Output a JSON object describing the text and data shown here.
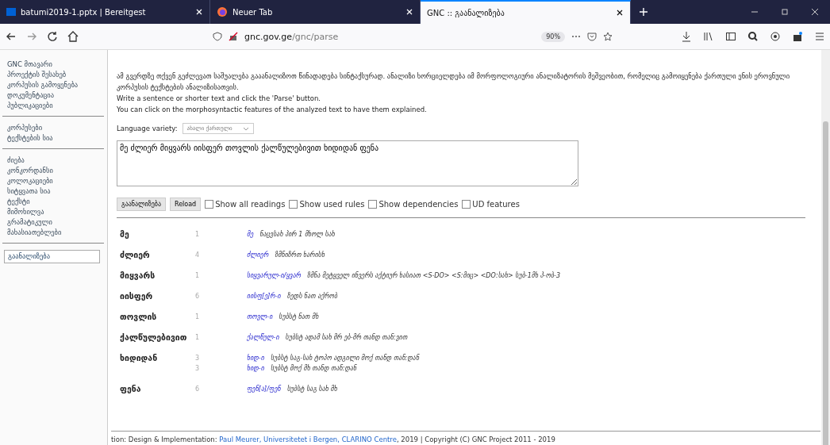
{
  "browser": {
    "tabs": [
      {
        "title": "batumi2019-1.pptx | Bereitgest",
        "selected": false,
        "kind": "box"
      },
      {
        "title": "Neuer Tab",
        "selected": false,
        "kind": "firefox"
      },
      {
        "title": "GNC :: გაანალიზება",
        "selected": true,
        "kind": "gnc"
      }
    ],
    "url_host": "gnc.gov.ge",
    "url_path": "/gnc/parse",
    "zoom": "90%"
  },
  "sidebar": {
    "groups": [
      [
        {
          "label": "GNC მთავარი",
          "selected": false
        },
        {
          "label": "პროექტის შესახებ",
          "selected": false
        },
        {
          "label": "კორპუსის გამოყენება",
          "selected": false
        },
        {
          "label": "დოკუმენტაცია",
          "selected": false
        },
        {
          "label": "პუბლიკაციები",
          "selected": false
        }
      ],
      [
        {
          "label": "კორპუსები",
          "selected": false
        },
        {
          "label": "ტექსტების სია",
          "selected": false
        }
      ],
      [
        {
          "label": "ძიება",
          "selected": false
        },
        {
          "label": "კონკორდანსი",
          "selected": false
        },
        {
          "label": "კოლოკაციები",
          "selected": false
        },
        {
          "label": "სიტყვათა სია",
          "selected": false
        },
        {
          "label": "ტექსტი",
          "selected": false
        },
        {
          "label": "მიმოხილვა",
          "selected": false
        },
        {
          "label": "გრამატიკული მახასიათებლები",
          "selected": false
        }
      ],
      [
        {
          "label": "გაანალიზება",
          "selected": true
        }
      ]
    ]
  },
  "intro": [
    "ამ გვერდზე თქვენ გეძლევათ საშუალება გააანალიზოთ წინადადება სინტაქსურად. ანალიზი ხორციელდება იმ მორფოლოგიური ანალიზატორის მეშვეობით, რომელიც გამოიყენება ქართული ენის ეროვნული კორპუსის ტექსტების ანალიზისათვის.",
    "Write a sentence or shorter text and click the 'Parse' button.",
    "You can click on the morphosyntactic features of the analyzed text to have them explained."
  ],
  "language_variety": {
    "label": "Language variety:",
    "value": "ახალი ქართული"
  },
  "input_text": "მე ძლიერ მიყვარს იისფერ თოვლის ქალწულებივით ხიდიდან ფენა",
  "buttons": [
    "გაანალიზება",
    "Reload"
  ],
  "options": [
    {
      "label": "Show all readings",
      "checked": false
    },
    {
      "label": "Show used rules",
      "checked": false
    },
    {
      "label": "Show dependencies",
      "checked": false
    },
    {
      "label": "UD features",
      "checked": false
    }
  ],
  "results": [
    {
      "word": "მე",
      "readings": [
        {
          "number": "1",
          "lemma": "მე",
          "features": "ნაცვსახ პირ 1 მხოლ სახ"
        }
      ]
    },
    {
      "word": "ძლიერ",
      "readings": [
        {
          "number": "4",
          "lemma": "ძლიერ",
          "features": "ზმნიზრთ ხარისხ"
        }
      ]
    },
    {
      "word": "მიყვარს",
      "readings": [
        {
          "number": "1",
          "lemma": "სიყვარულ-ი/ყვარ",
          "features": "ზმნა მეტყველ ინვერს აქტიურ ხასიათ <S-DO> <S:მიც> <DO:სახ> სუბ-1მხ პ-ობ-3"
        }
      ]
    },
    {
      "word": "იისფერ",
      "readings": [
        {
          "number": "6",
          "lemma": "იისფ[ე]რ-ი",
          "features": "ზედს ნათ აქრობ"
        }
      ]
    },
    {
      "word": "თოვლის",
      "readings": [
        {
          "number": "1",
          "lemma": "თოვლ-ი",
          "features": "სუბსტ ნათ მხ"
        }
      ]
    },
    {
      "word": "ქალწულებივით",
      "readings": [
        {
          "number": "1",
          "lemma": "ქალწულ-ი",
          "features": "სუბსტ ადამ სახ მრ ებ-მრ თანდ თან:ვით"
        }
      ]
    },
    {
      "word": "ხიდიდან",
      "readings": [
        {
          "number": "3",
          "lemma": "ხიდ-ი",
          "features": "სუბსტ საგ-სახ ტოპო ადგილი მოქ თანდ თან:დან"
        },
        {
          "number": "3",
          "lemma": "ხიდ-ი",
          "features": "სუბსტ მოქ მხ თანდ თან:დან"
        }
      ]
    },
    {
      "word": "ფენა",
      "readings": [
        {
          "number": "6",
          "lemma": "ფენ[ა]/ფენ",
          "features": "სუბსტ საგ სახ მხ"
        }
      ]
    }
  ],
  "footer": {
    "before": "tion: Design & Implementation: ",
    "link": "Paul Meurer, Universitetet i Bergen, CLARINO Centre",
    "after": ", 2019 | Copyright (C) GNC Project 2011 - 2019"
  }
}
